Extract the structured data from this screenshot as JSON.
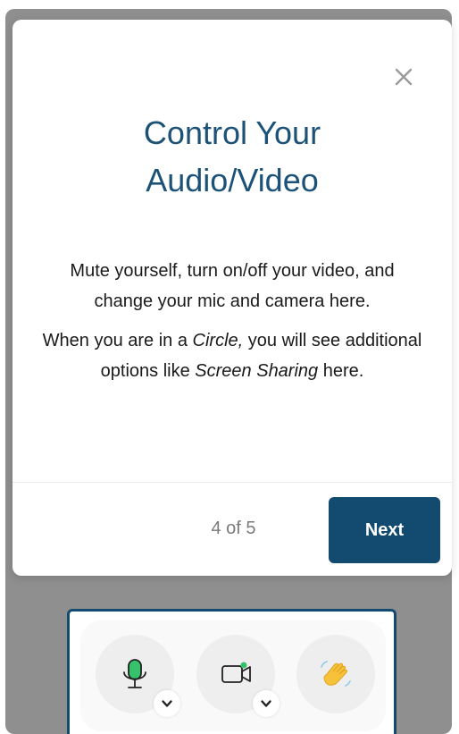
{
  "tooltip": {
    "title_line1": "Control Your",
    "title_line2": "Audio/Video",
    "paragraph1": "Mute yourself, turn on/off your video, and change your mic and camera here.",
    "paragraph2_part1": "When you are in a ",
    "paragraph2_italic1": "Circle,",
    "paragraph2_part2": " you will see additional options like ",
    "paragraph2_italic2": "Screen Sharing",
    "paragraph2_part3": " here.",
    "step": "4 of 5",
    "next_label": "Next"
  },
  "controls": {
    "icons": [
      "microphone-icon",
      "camera-icon",
      "waving-hand-icon"
    ]
  },
  "colors": {
    "accent": "#134a70",
    "title": "#1c5277",
    "mic_active": "#36c26a",
    "camera_active": "#36c26a",
    "hand": "#f7c23a"
  }
}
